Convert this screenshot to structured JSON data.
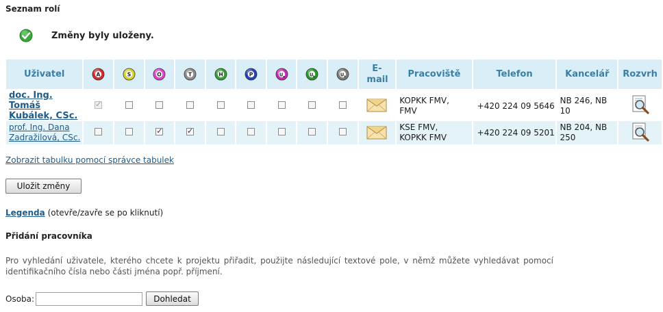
{
  "page": {
    "section_title": "Seznam rolí",
    "success_message": "Změny byly uloženy."
  },
  "table": {
    "col_user": "Uživatel",
    "roles": [
      {
        "letter": "A",
        "color": "#d42a2a"
      },
      {
        "letter": "S",
        "color": "#d8d41c"
      },
      {
        "letter": "O",
        "color": "#e83ed6"
      },
      {
        "letter": "T",
        "color": "#8c8c8c"
      },
      {
        "letter": "H",
        "color": "#2ea42e"
      },
      {
        "letter": "P",
        "color": "#2340c8"
      },
      {
        "letter": "U",
        "sub": "o",
        "color": "#c62ab8"
      },
      {
        "letter": "U",
        "sub": "h",
        "color": "#249a2a"
      },
      {
        "letter": "U",
        "sub": "t",
        "color": "#7c7c7c"
      }
    ],
    "col_email": "E-mail",
    "col_work": "Pracoviště",
    "col_phone": "Telefon",
    "col_office": "Kancelář",
    "col_schedule": "Rozvrh",
    "rows": [
      {
        "name_line1": "doc. Ing. Tomáš",
        "name_line2": "Kubálek, CSc.",
        "checks": [
          true,
          false,
          false,
          false,
          false,
          false,
          false,
          false,
          false
        ],
        "first_disabled": true,
        "work_line1": "KOPKK FMV,",
        "work_line2": "FMV",
        "phone": "+420 224 09 5646",
        "office_line1": "NB 246, NB",
        "office_line2": "10"
      },
      {
        "name_line1": "prof. Ing. Dana",
        "name_line2": "Zadražilová, CSc.",
        "checks": [
          false,
          false,
          true,
          true,
          false,
          false,
          false,
          false,
          false
        ],
        "first_disabled": false,
        "work_line1": "KSE FMV,",
        "work_line2": "KOPKK FMV",
        "phone": "+420 224 09 5201",
        "office_line1": "NB 204, NB",
        "office_line2": "250"
      }
    ]
  },
  "links": {
    "show_table_manager": "Zobrazit tabulku pomocí správce tabulek"
  },
  "buttons": {
    "save": "Uložit změny",
    "search": "Dohledat"
  },
  "legend": {
    "link": "Legenda",
    "hint": " (otevře/zavře se po kliknutí)"
  },
  "add_worker": {
    "title": "Přidání pracovníka",
    "help": "Pro vyhledání uživatele, kterého chcete k projektu přiřadit, použijte následující textové pole, v němž můžete vyhledávat pomocí identifikačního čísla nebo části jména popř. příjmení.",
    "person_label": "Osoba:",
    "person_value": ""
  }
}
